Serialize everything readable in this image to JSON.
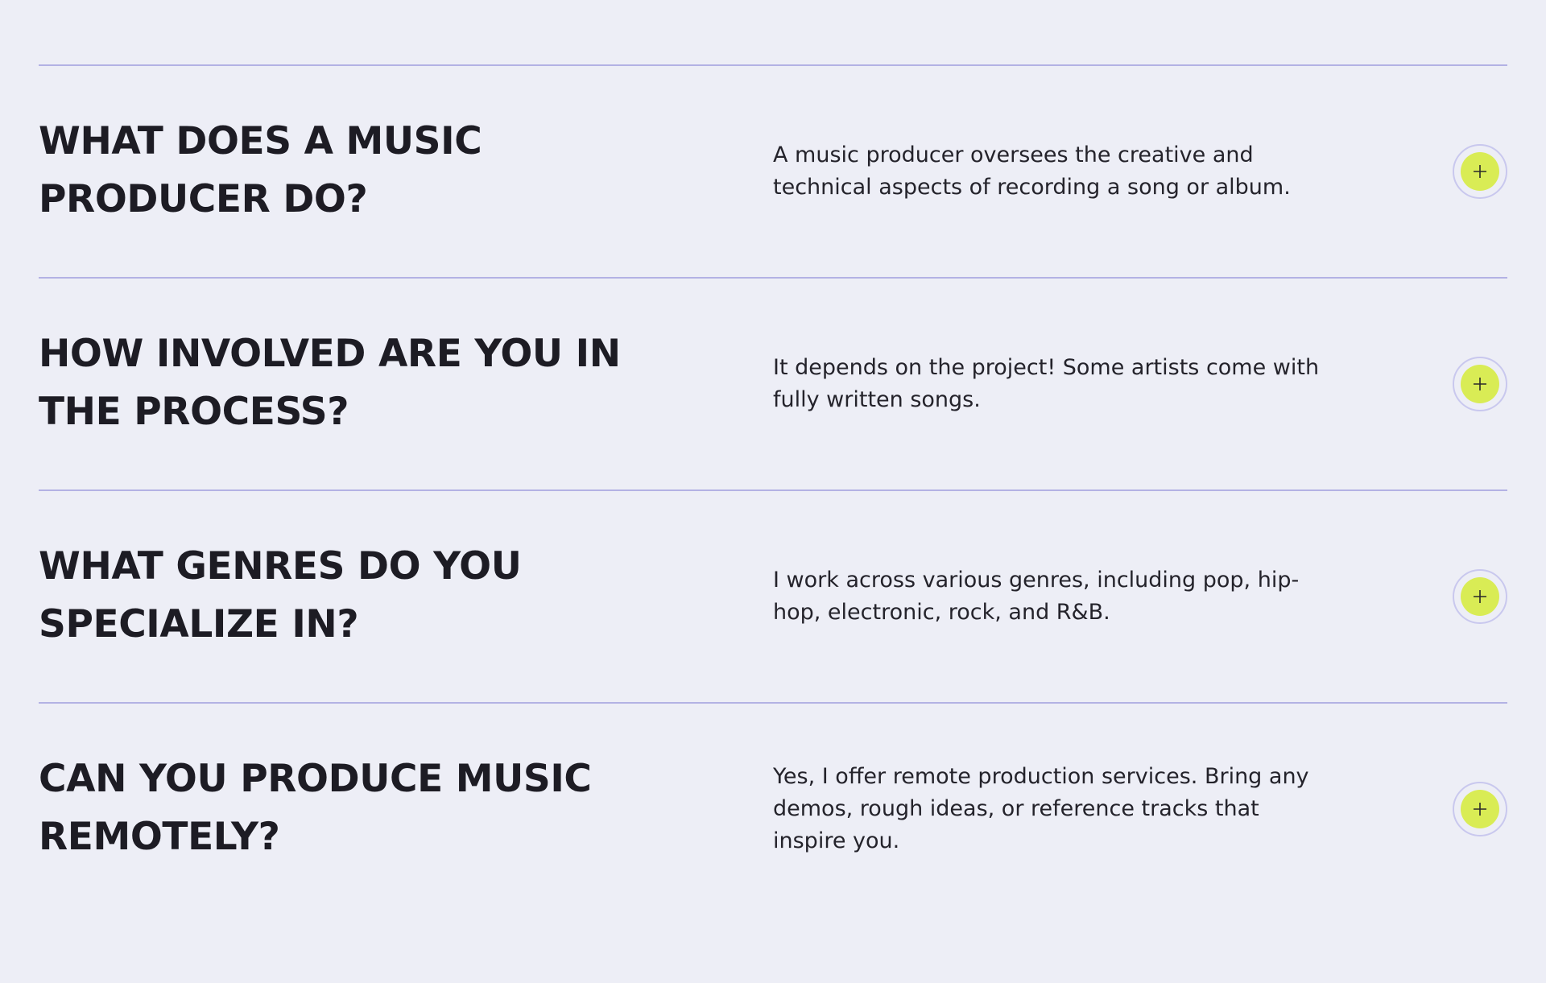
{
  "faq": {
    "items": [
      {
        "question": "What does a music producer do?",
        "answer": "A music producer oversees the creative and technical aspects of recording a song or album.",
        "toggle_icon": "plus-icon"
      },
      {
        "question": "How involved are you in the process?",
        "answer": "It depends on the project! Some artists come with fully written songs.",
        "toggle_icon": "plus-icon"
      },
      {
        "question": "What genres do you specialize in?",
        "answer": "I work across various genres, including pop, hip-hop, electronic, rock, and R&B.",
        "toggle_icon": "plus-icon"
      },
      {
        "question": "Can you produce music remotely?",
        "answer": "Yes, I offer remote production services. Bring any demos, rough ideas, or reference tracks that inspire you.",
        "toggle_icon": "plus-icon"
      }
    ]
  },
  "colors": {
    "background": "#edeef6",
    "divider": "#b3b2e4",
    "accent": "#d9ec55",
    "text": "#1d1c24"
  }
}
